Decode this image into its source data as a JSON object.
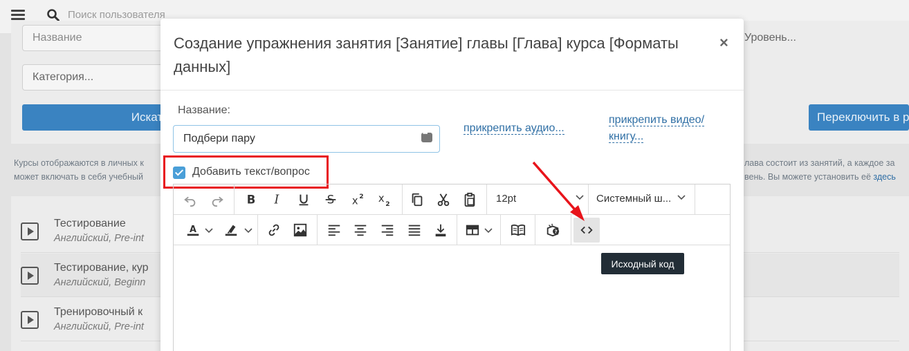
{
  "topbar": {
    "search_placeholder": "Поиск пользователя"
  },
  "filters": {
    "name_placeholder": "Название",
    "level_placeholder": "Уровень...",
    "category_placeholder": "Категория...",
    "search_button": "Искать",
    "switch_button": "Переключить в р"
  },
  "info": {
    "left_line1": "Курсы отображаются в личных к",
    "left_line2": "может включать в себя учебный",
    "right_line1": "лава состоит из занятий, а каждое за",
    "right_line2": "вень. Вы можете установить её",
    "right_link": "здесь"
  },
  "courses": [
    {
      "title": "Тестирование",
      "subtitle": "Английский, Pre-int"
    },
    {
      "title": "Тестирование, кур",
      "subtitle": "Английский, Beginn"
    },
    {
      "title": "Тренировочный к",
      "subtitle": "Английский, Pre-int"
    }
  ],
  "modal": {
    "title": "Создание упражнения занятия [Занятие] главы [Глава] курса [Форматы данных]",
    "close": "×",
    "name_label": "Название:",
    "name_value": "Подбери пару",
    "attach_audio": "прикрепить аудио...",
    "attach_video_line1": "прикрепить видео/",
    "attach_video_line2": "книгу...",
    "add_text_label": "Добавить текст/вопрос",
    "font_size": "12pt",
    "font_family": "Системный ш...",
    "tooltip": "Исходный код"
  },
  "colors": {
    "accent": "#3a83c1",
    "highlight": "#e8141b",
    "checkbox": "#4a9fd8",
    "tooltip_bg": "#222d36"
  }
}
